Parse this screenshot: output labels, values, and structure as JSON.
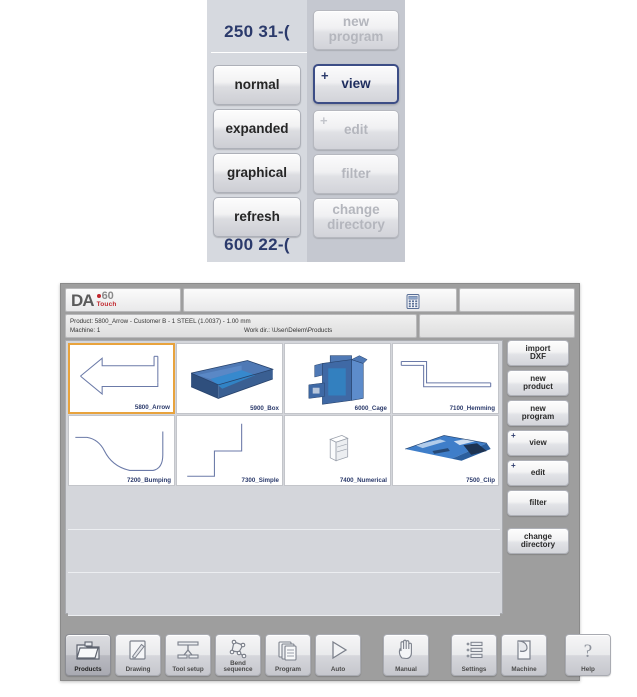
{
  "detail_panel": {
    "number_top": "250 31-(",
    "number_bottom": "600 22-(",
    "left_buttons": [
      {
        "label": "normal",
        "enabled": true
      },
      {
        "label": "expanded",
        "enabled": true
      },
      {
        "label": "graphical",
        "enabled": true
      },
      {
        "label": "refresh",
        "enabled": true
      }
    ],
    "right_buttons": [
      {
        "label": "new\nprogram",
        "enabled": false,
        "plus": false,
        "selected": false
      },
      {
        "label": "view",
        "enabled": true,
        "plus": true,
        "selected": true
      },
      {
        "label": "edit",
        "enabled": false,
        "plus": true,
        "selected": false
      },
      {
        "label": "filter",
        "enabled": false,
        "plus": false,
        "selected": false
      },
      {
        "label": "change\ndirectory",
        "enabled": false,
        "plus": false,
        "selected": false
      }
    ]
  },
  "app": {
    "logo": {
      "brand": "DA",
      "model": "60",
      "sub": "Touch"
    },
    "header_icons": [
      {
        "name": "calculator-icon"
      },
      {
        "name": "unlocked-padlock-icon"
      }
    ],
    "status": {
      "product": "Product: 5800_Arrow - Customer B - 1 STEEL (1.0037) - 1.00 mm",
      "machine": "Machine: 1",
      "work_dir": "Work dir.: \\User\\Delem\\Products"
    },
    "products": [
      {
        "name": "5800_Arrow",
        "selected": true,
        "art": "arrow"
      },
      {
        "name": "5900_Box",
        "selected": false,
        "art": "box"
      },
      {
        "name": "6000_Cage",
        "selected": false,
        "art": "cage"
      },
      {
        "name": "7100_Hemming",
        "selected": false,
        "art": "hemming"
      },
      {
        "name": "7200_Bumping",
        "selected": false,
        "art": "bumping"
      },
      {
        "name": "7300_Simple",
        "selected": false,
        "art": "simple"
      },
      {
        "name": "7400_Numerical",
        "selected": false,
        "art": "numerical"
      },
      {
        "name": "7500_Clip",
        "selected": false,
        "art": "clip"
      }
    ],
    "side_buttons": [
      {
        "label": "import\nDXF",
        "plus": false
      },
      {
        "label": "new\nproduct",
        "plus": false
      },
      {
        "label": "new\nprogram",
        "plus": false
      },
      {
        "label": "view",
        "plus": true
      },
      {
        "label": "edit",
        "plus": true
      },
      {
        "label": "filter",
        "plus": false
      },
      {
        "label": "change\ndirectory",
        "plus": false
      }
    ],
    "toolbar": [
      {
        "label": "Products",
        "icon": "folder-icon",
        "active": true
      },
      {
        "label": "Drawing",
        "icon": "pencil-page-icon",
        "active": false
      },
      {
        "label": "Tool setup",
        "icon": "press-tool-icon",
        "active": false
      },
      {
        "label": "Bend\nsequence",
        "icon": "bend-sequence-icon",
        "active": false
      },
      {
        "label": "Program",
        "icon": "pages-stack-icon",
        "active": false
      },
      {
        "label": "Auto",
        "icon": "play-triangle-icon",
        "active": false
      },
      {
        "label": "Manual",
        "icon": "hand-icon",
        "active": false
      },
      {
        "label": "Settings",
        "icon": "list-settings-icon",
        "active": false
      },
      {
        "label": "Machine",
        "icon": "page-curl-icon",
        "active": false
      },
      {
        "label": "Help",
        "icon": "question-mark-icon",
        "active": false
      }
    ]
  },
  "colors": {
    "selection_orange": "#e8a33d",
    "label_blue": "#2b3a6b",
    "brand_red": "#c1272d",
    "part_blue": "#3a6bb0"
  }
}
